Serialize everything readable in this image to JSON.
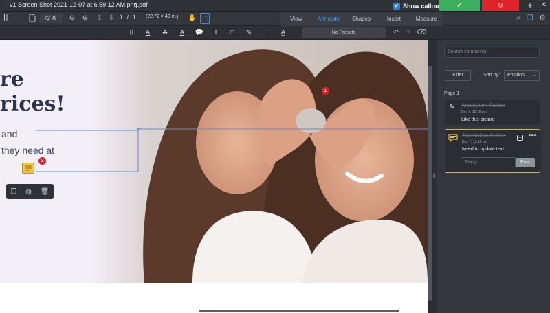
{
  "titlebar": {
    "title": "v1 Screen Shot 2021-12-07 at 6.59.12 AM.png.pdf",
    "dropdown_glyph": "▼",
    "show_callouts_label": "Show callouts",
    "accept_glyph": "✓",
    "reject_glyph": "⦸",
    "plus_glyph": "+",
    "close_glyph": "✕"
  },
  "toolbar": {
    "zoom": "72 %",
    "page_current": "1",
    "page_sep": "/",
    "page_total": "1",
    "page_size": "(22.72 × 40 in.)",
    "modes": [
      "View",
      "Annotate",
      "Shapes",
      "Insert",
      "Measure"
    ],
    "active_mode": "Annotate",
    "presets": "No Presets"
  },
  "document": {
    "heading_line1": "re",
    "heading_line2": "rices!",
    "body_line1": "and",
    "body_line2": "they need at",
    "badge_1": "1",
    "badge_2": "2"
  },
  "panel": {
    "search_placeholder": "Search comments",
    "filter_label": "Filter",
    "sort_label": "Sort by:",
    "sort_value": "Position",
    "page_label": "Page 1",
    "comments": [
      {
        "author": "Annotation Author",
        "date": "Dec 7, 12:18 pm",
        "text": "Like this picture"
      },
      {
        "author": "Annotation Author",
        "date": "Dec 7, 12:19 pm",
        "text": "Need to update text"
      }
    ],
    "reply_placeholder": "Reply...",
    "post_label": "Post"
  },
  "colors": {
    "accent": "#3a8ee6",
    "accept": "#3db05f",
    "reject": "#e0252a",
    "note": "#f2c53d",
    "heading": "#2c3352"
  }
}
